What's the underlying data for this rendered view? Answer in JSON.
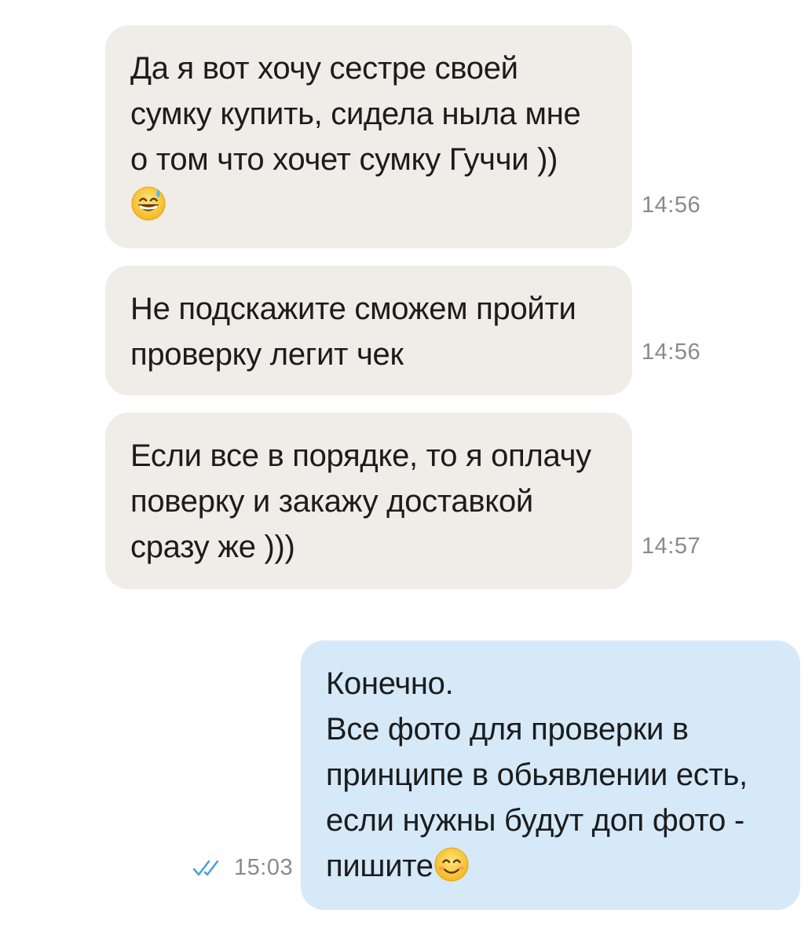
{
  "messages": [
    {
      "direction": "incoming",
      "lines": [
        "Да я вот хочу сестре своей",
        "сумку купить, сидела ныла мне",
        "о том что хочет сумку Гуччи ))"
      ],
      "emoji": "grinning-sweat-emoji",
      "time": "14:56"
    },
    {
      "direction": "incoming",
      "lines": [
        "Не подскажите сможем пройти",
        "проверку легит чек"
      ],
      "time": "14:56"
    },
    {
      "direction": "incoming",
      "lines": [
        "Если все в порядке, то я оплачу",
        "поверку и закажу доставкой",
        "сразу же )))"
      ],
      "time": "14:57"
    },
    {
      "direction": "outgoing",
      "lines": [
        "Конечно.",
        "Все фото для проверки в",
        "принципе в обьявлении есть,",
        "если нужны будут доп фото -",
        "пишите"
      ],
      "emoji": "smiling-emoji",
      "time": "15:03",
      "status": "read",
      "status_icon": "double-check-icon"
    }
  ],
  "colors": {
    "incoming_bubble": "#f0ede8",
    "outgoing_bubble": "#d5e9f9",
    "timestamp": "#8a8a8a",
    "read_check": "#4a9ee6"
  }
}
